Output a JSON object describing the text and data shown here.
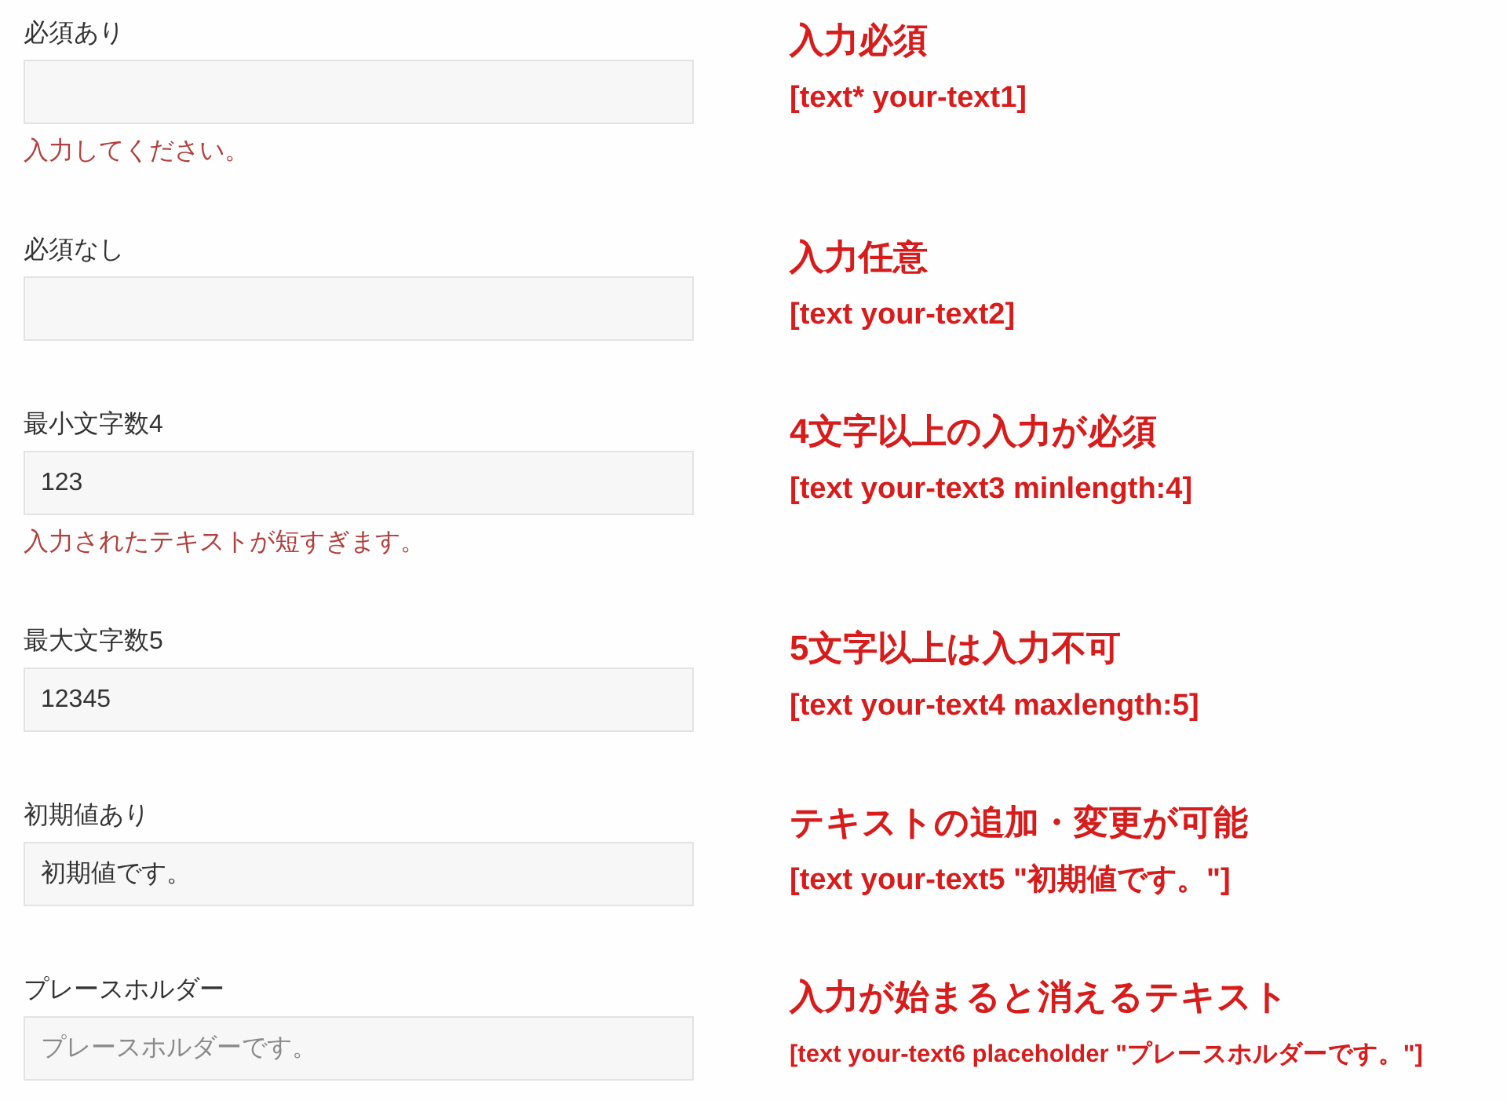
{
  "fields": [
    {
      "label": "必須あり",
      "error": "入力してください。",
      "note": {
        "title": "入力必須",
        "code": "[text* your-text1]"
      }
    },
    {
      "label": "必須なし",
      "note": {
        "title": "入力任意",
        "code": "[text your-text2]"
      }
    },
    {
      "label": "最小文字数4",
      "value": "123",
      "error": "入力されたテキストが短すぎます。",
      "note": {
        "title": "4文字以上の入力が必須",
        "code": "[text your-text3 minlength:4]"
      }
    },
    {
      "label": "最大文字数5",
      "value": "12345",
      "note": {
        "title": "5文字以上は入力不可",
        "code": "[text your-text4 maxlength:5]"
      }
    },
    {
      "label": "初期値あり",
      "value": "初期値です。",
      "note": {
        "title": "テキストの追加・変更が可能",
        "code": "[text your-text5 \"初期値です。\"]"
      }
    },
    {
      "label": "プレースホルダー",
      "placeholder": "プレースホルダーです。",
      "note": {
        "title": "入力が始まると消えるテキスト",
        "code": "[text your-text6 placeholder \"プレースホルダーです。\"]"
      }
    }
  ]
}
